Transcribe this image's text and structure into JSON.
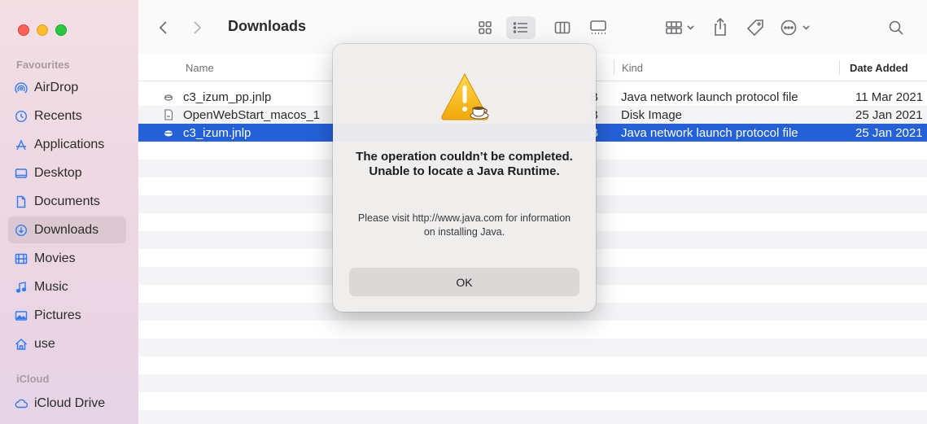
{
  "window": {
    "title": "Downloads"
  },
  "sidebar": {
    "favourites_label": "Favourites",
    "icloud_label": "iCloud",
    "items": [
      {
        "label": "AirDrop",
        "icon": "airdrop-icon"
      },
      {
        "label": "Recents",
        "icon": "clock-icon"
      },
      {
        "label": "Applications",
        "icon": "applications-icon"
      },
      {
        "label": "Desktop",
        "icon": "desktop-icon"
      },
      {
        "label": "Documents",
        "icon": "document-icon"
      },
      {
        "label": "Downloads",
        "icon": "download-icon",
        "active": true
      },
      {
        "label": "Movies",
        "icon": "film-icon"
      },
      {
        "label": "Music",
        "icon": "music-note-icon"
      },
      {
        "label": "Pictures",
        "icon": "photo-icon"
      },
      {
        "label": "use",
        "icon": "home-icon"
      }
    ],
    "icloud_items": [
      {
        "label": "iCloud Drive",
        "icon": "cloud-icon"
      }
    ]
  },
  "toolbar": {
    "back": "back-chevron-icon",
    "forward": "forward-chevron-icon",
    "views": [
      "icon-view",
      "list-view",
      "column-view",
      "gallery-view"
    ],
    "active_view": "list-view",
    "group": "group-by-icon",
    "share": "share-icon",
    "tag": "tag-icon",
    "more": "more-actions-icon",
    "search": "search-icon"
  },
  "columns": {
    "name": "Name",
    "kind": "Kind",
    "date_added": "Date Added"
  },
  "files": [
    {
      "name": "c3_izum_pp.jnlp",
      "size_tail": "B",
      "kind": "Java network launch protocol file",
      "date": "11 Mar 2021"
    },
    {
      "name": "OpenWebStart_macos_1",
      "size_tail": "B",
      "kind": "Disk Image",
      "date": "25 Jan 2021"
    },
    {
      "name": "c3_izum.jnlp",
      "size_tail": "B",
      "kind": "Java network launch protocol file",
      "date": "25 Jan 2021",
      "selected": true
    }
  ],
  "dialog": {
    "icon": "java-warning-icon",
    "title": "The operation couldn’t be completed. Unable to locate a Java Runtime.",
    "message": "Please visit http://www.java.com for information on installing Java.",
    "ok_label": "OK"
  },
  "colors": {
    "selection": "#2460d8",
    "sidebar_icon": "#2f7cf6",
    "active_sidebar": "#dcc8d0"
  }
}
